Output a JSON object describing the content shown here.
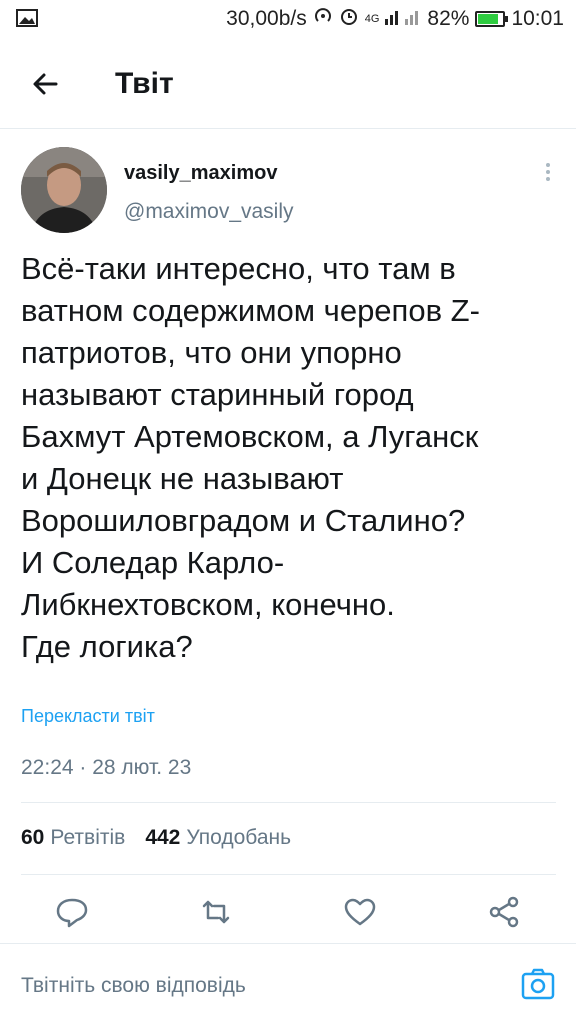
{
  "status_bar": {
    "speed": "30,00b/s",
    "network": "4G",
    "battery_percent": "82%",
    "battery_level": 0.82,
    "time": "10:01"
  },
  "header": {
    "title": "Твіт"
  },
  "tweet": {
    "display_name": "vasily_maximov",
    "handle": "@maximov_vasily",
    "text_lines": [
      "Всё-таки интересно, что там в",
      "ватном содержимом черепов Z-",
      "патриотов, что они упорно",
      "называют старинный город",
      "Бахмут Артемовском, а Луганск",
      "и Донецк не называют",
      "Ворошиловградом и Сталино?",
      "И Соледар Карло-",
      "Либкнехтовском, конечно.",
      "Где логика?"
    ],
    "translate_label": "Перекласти твіт",
    "timestamp": "22:24 · 28 лют. 23",
    "retweets_count": "60",
    "retweets_label": "Ретвітів",
    "likes_count": "442",
    "likes_label": "Уподобань"
  },
  "reply": {
    "placeholder": "Твітніть свою відповідь"
  },
  "colors": {
    "accent": "#1da1f2",
    "secondary_text": "#657786",
    "icon_gray": "#657786",
    "divider": "#e6ecf0"
  }
}
